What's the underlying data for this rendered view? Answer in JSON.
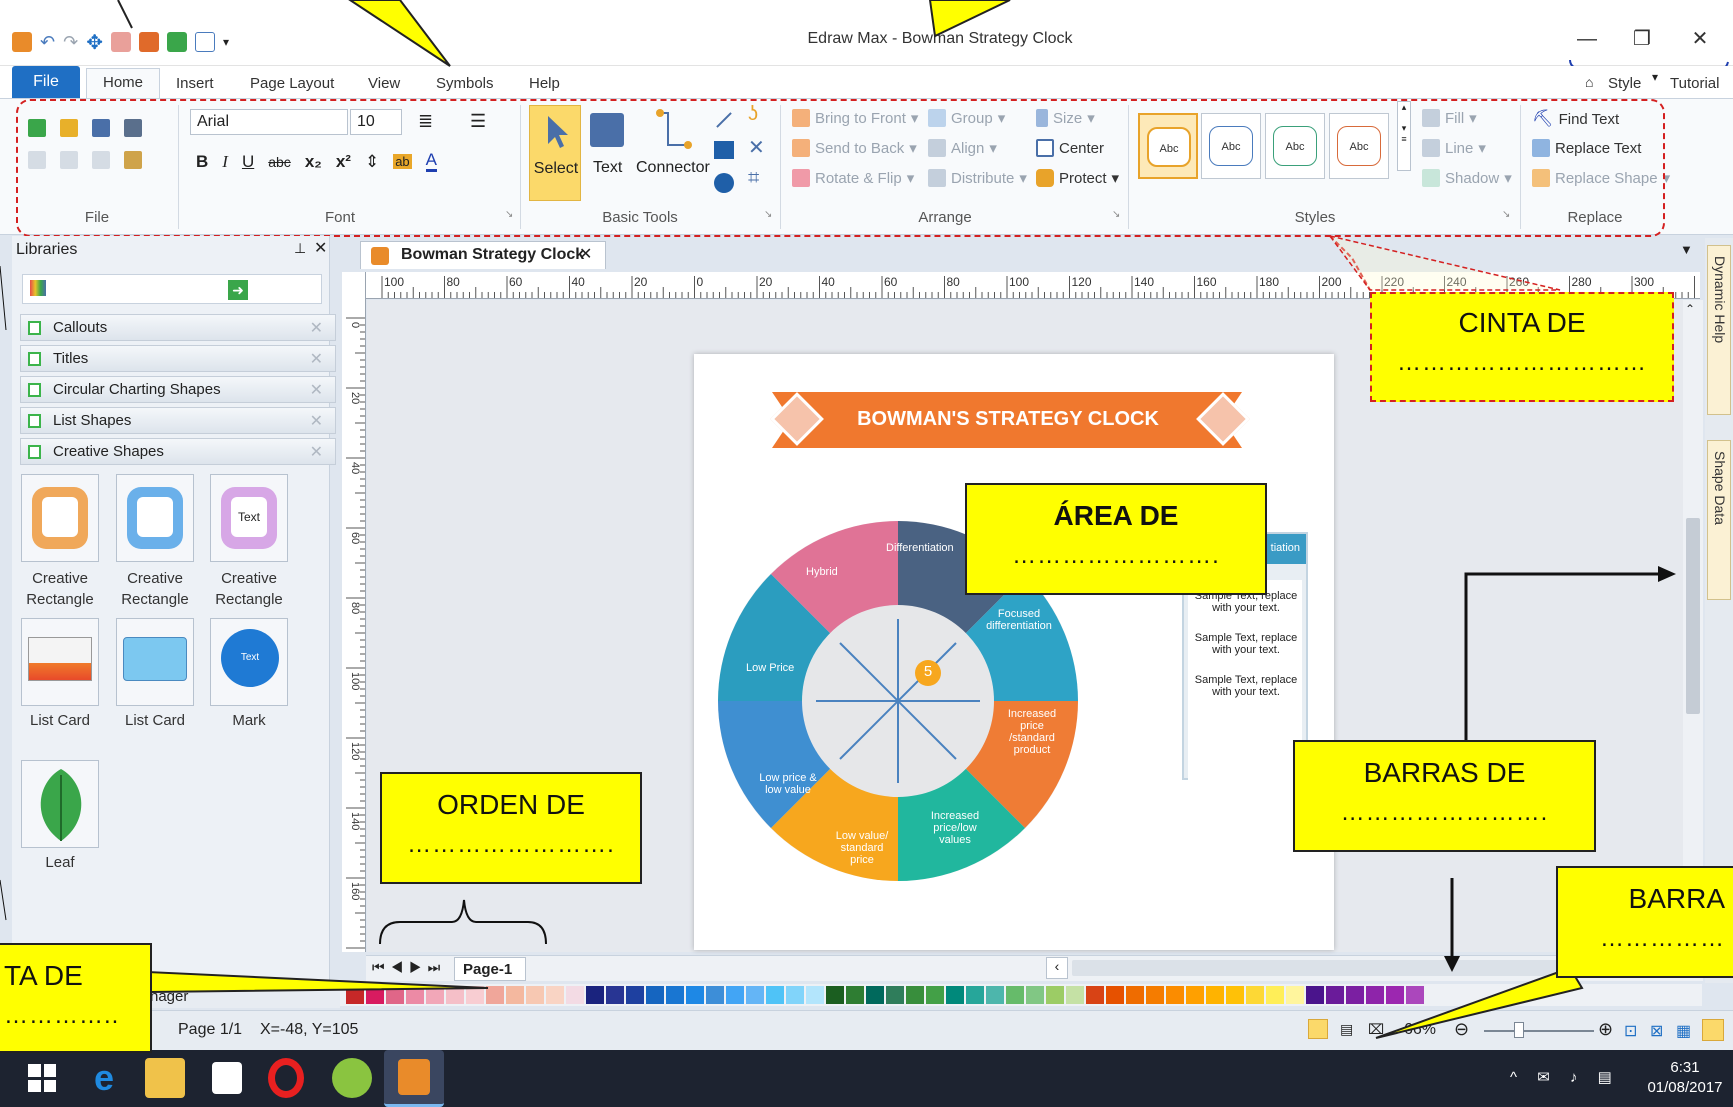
{
  "window": {
    "title": "Edraw Max - Bowman Strategy Clock",
    "minimize": "—",
    "restore": "❐",
    "close": "✕"
  },
  "menu": {
    "file": "File",
    "home": "Home",
    "insert": "Insert",
    "page_layout": "Page Layout",
    "view": "View",
    "symbols": "Symbols",
    "help": "Help",
    "style": "Style",
    "tutorial": "Tutorial"
  },
  "ribbon": {
    "groups": {
      "file": "File",
      "font": "Font",
      "basic_tools": "Basic Tools",
      "arrange": "Arrange",
      "styles": "Styles",
      "replace": "Replace"
    },
    "font_name": "Arial",
    "font_size": "10",
    "bold": "B",
    "italic": "I",
    "underline": "U",
    "strike": "abc",
    "subscript": "x₂",
    "superscript": "x²",
    "select": "Select",
    "text": "Text",
    "connector": "Connector",
    "bring_to_front": "Bring to Front",
    "send_to_back": "Send to Back",
    "rotate_flip": "Rotate & Flip",
    "group": "Group",
    "align": "Align",
    "distribute": "Distribute",
    "size": "Size",
    "center": "Center",
    "protect": "Protect",
    "style_sample": "Abc",
    "fill": "Fill",
    "line": "Line",
    "shadow": "Shadow",
    "find_text": "Find Text",
    "replace_text": "Replace Text",
    "replace_shape": "Replace Shape"
  },
  "libraries": {
    "title": "Libraries",
    "categories": [
      "Callouts",
      "Titles",
      "Circular Charting Shapes",
      "List Shapes",
      "Creative Shapes"
    ],
    "shapes": [
      {
        "label": "Creative Rectangle"
      },
      {
        "label": "Creative Rectangle"
      },
      {
        "label": "Creative Rectangle",
        "tile_text": "Text"
      },
      {
        "label": "List Card"
      },
      {
        "label": "List Card"
      },
      {
        "label": "Mark",
        "tile_text": "Text"
      },
      {
        "label": "Leaf"
      }
    ],
    "manager": "nager"
  },
  "document": {
    "tab_title": "Bowman Strategy Clock",
    "page_tab": "Page-1",
    "ruler_h": [
      "100",
      "80",
      "60",
      "40",
      "20",
      "0",
      "20",
      "40",
      "60",
      "80",
      "100",
      "120",
      "140",
      "160",
      "180",
      "200",
      "220",
      "240",
      "260",
      "280",
      "300"
    ],
    "ruler_v": [
      "0",
      "20",
      "40",
      "60",
      "80",
      "100",
      "120",
      "140",
      "160"
    ]
  },
  "diagram": {
    "banner": "BOWMAN'S STRATEGY CLOCK",
    "center_number": "5",
    "segments": {
      "differentiation": "Differentiation",
      "hybrid": "Hybrid",
      "focused": "Focused differentiation",
      "low_price": "Low Price",
      "increased_price": "Increased price /standard product",
      "low_price_low_value": "Low price & low value",
      "low_value": "Low value/ standard price",
      "increased_price_low": "Increased price/low values"
    },
    "side_header": "tiation",
    "side_texts": [
      "Sample Text, replace with your text.",
      "Sample Text, replace with your text.",
      "Sample Text, replace with your text."
    ]
  },
  "dock": {
    "dynamic_help": "Dynamic Help",
    "shape_data": "Shape Data"
  },
  "status": {
    "page": "Page 1/1",
    "coords": "X=-48, Y=105",
    "zoom": "66%"
  },
  "taskbar": {
    "time": "6:31",
    "date": "01/08/2017"
  },
  "callouts": {
    "cinta": {
      "line1": "CINTA DE",
      "line2": "…………………………"
    },
    "area": {
      "line1": "ÁREA DE",
      "line2": "……………………."
    },
    "orden": {
      "line1": "ORDEN DE",
      "line2": "……………………."
    },
    "barras": {
      "line1": "BARRAS DE",
      "line2": "……………………."
    },
    "barra": {
      "line1": "BARRA",
      "line2": "……………"
    },
    "ta": {
      "line1": "TA DE",
      "line2": "………….."
    }
  },
  "palette": [
    "#c62828",
    "#d81b60",
    "#e06688",
    "#ec8aa5",
    "#f2a7b8",
    "#f5bfc8",
    "#f8cdd2",
    "#f0a69a",
    "#f4b89f",
    "#f7c8b2",
    "#f9d4c4",
    "#f3dbe4",
    "#1a237e",
    "#283593",
    "#1e40a0",
    "#1565c0",
    "#1976d2",
    "#1e88e5",
    "#3d8ed8",
    "#42a5f5",
    "#64b5f6",
    "#4fc3f7",
    "#81d4fa",
    "#b3e5fc",
    "#1b5e20",
    "#2e7d32",
    "#00695c",
    "#2f7d5b",
    "#388e3c",
    "#43a047",
    "#00897b",
    "#26a69a",
    "#4db6ac",
    "#66bb6a",
    "#81c784",
    "#9ccc65",
    "#c5e1a5",
    "#d84315",
    "#e65100",
    "#ef6c00",
    "#f57c00",
    "#fb8c00",
    "#ffa000",
    "#ffb300",
    "#ffc107",
    "#fdd835",
    "#ffee58",
    "#fff59d",
    "#4a148c",
    "#6a1b9a",
    "#7b1fa2",
    "#8e24aa",
    "#9c27b0",
    "#ab47bc"
  ]
}
